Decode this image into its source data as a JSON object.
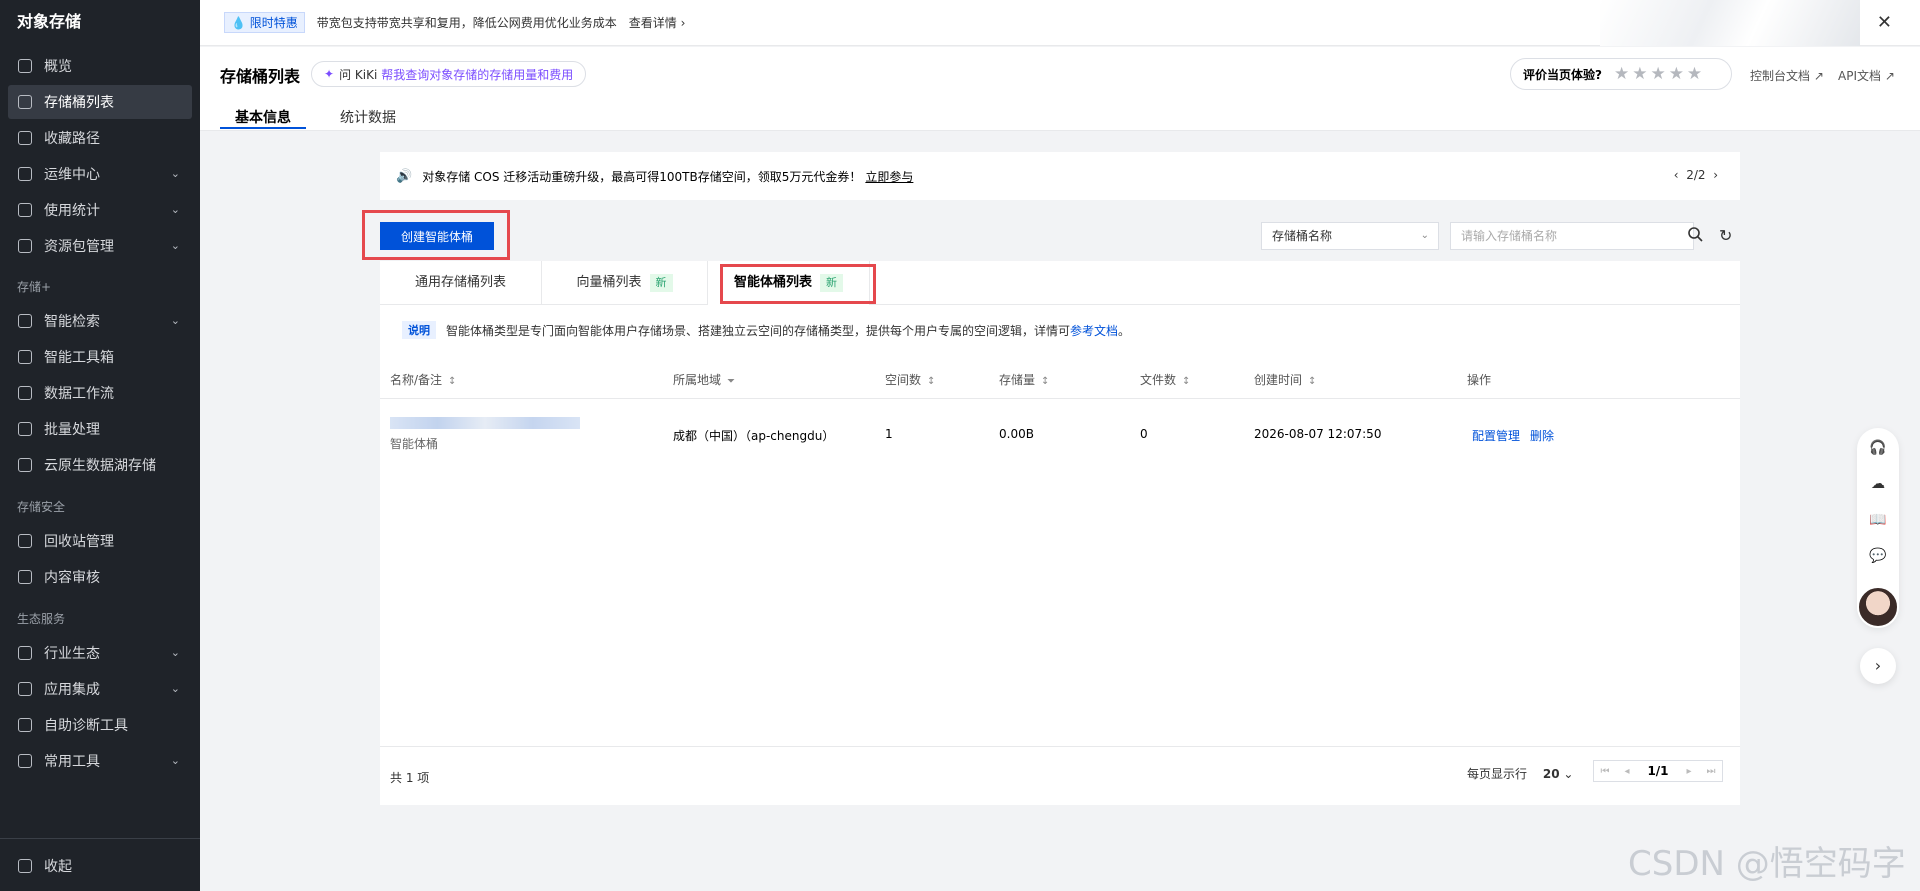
{
  "sidebar": {
    "title": "对象存储",
    "items": [
      {
        "label": "概览"
      },
      {
        "label": "存储桶列表"
      },
      {
        "label": "收藏路径"
      },
      {
        "label": "运维中心"
      },
      {
        "label": "使用统计"
      },
      {
        "label": "资源包管理"
      },
      {
        "label": "智能检索"
      },
      {
        "label": "智能工具箱"
      },
      {
        "label": "数据工作流"
      },
      {
        "label": "批量处理"
      },
      {
        "label": "云原生数据湖存储"
      },
      {
        "label": "回收站管理"
      },
      {
        "label": "内容审核"
      },
      {
        "label": "行业生态"
      },
      {
        "label": "应用集成"
      },
      {
        "label": "自助诊断工具"
      },
      {
        "label": "常用工具"
      }
    ],
    "sections": [
      "存储+",
      "存储安全",
      "生态服务"
    ],
    "collapse_label": "收起"
  },
  "topbar": {
    "promo_tag": "限时特惠",
    "notice": "带宽包支持带宽共享和复用，降低公网费用优化业务成本",
    "detail": "查看详情"
  },
  "header": {
    "title": "存储桶列表",
    "kiki_label": "问 KiKi",
    "kiki_hint": "帮我查询对象存储的存储用量和费用",
    "tabs": [
      "基本信息",
      "统计数据"
    ],
    "rating_label": "评价当页体验?",
    "stars": "★★★★★",
    "links": [
      "控制台文档",
      "API文档"
    ]
  },
  "banner": {
    "text": "对象存储 COS 迁移活动重磅升级，最高可得100TB存储空间，领取5万元代金券！",
    "join": "立即参与",
    "pager": "2/2"
  },
  "toolbar": {
    "create_label": "创建智能体桶",
    "select_value": "存储桶名称",
    "search_placeholder": "请输入存储桶名称"
  },
  "bucket_tabs": [
    {
      "label": "通用存储桶列表"
    },
    {
      "label": "向量桶列表",
      "badge": "新"
    },
    {
      "label": "智能体桶列表",
      "badge": "新"
    }
  ],
  "note": {
    "tag": "说明",
    "text": "智能体桶类型是专门面向智能体用户存储场景、搭建独立云空间的存储桶类型，提供每个用户专属的空间逻辑，详情可",
    "link": "参考文档",
    "end": "。"
  },
  "table": {
    "columns": [
      "名称/备注",
      "所属地域",
      "空间数",
      "存储量",
      "文件数",
      "创建时间",
      "操作"
    ],
    "rows": [
      {
        "remark": "智能体桶",
        "region": "成都（中国）（ap-chengdu）",
        "spaces": "1",
        "storage": "0.00B",
        "files": "0",
        "created": "2026-08-07 12:07:50",
        "actions": [
          "配置管理",
          "删除"
        ]
      }
    ]
  },
  "footer": {
    "total": "共 1 项",
    "perpage_label": "每页显示行",
    "perpage_value": "20",
    "page": "1/1"
  },
  "watermark": "CSDN @悟空码字",
  "colors": {
    "accent": "#0052d9",
    "highlight": "#e5484d",
    "sidebar_bg": "#1f2329"
  }
}
